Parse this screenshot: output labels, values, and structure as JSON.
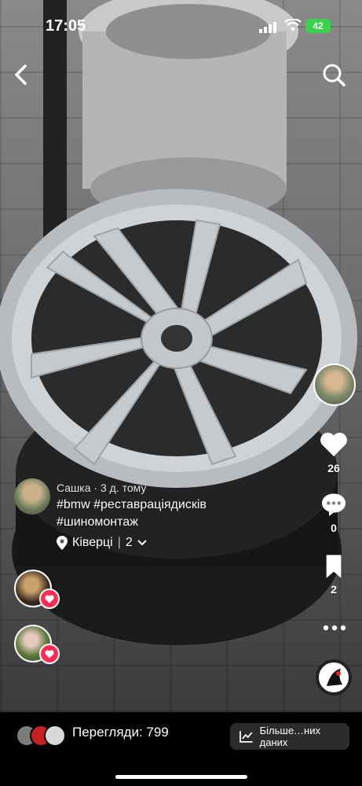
{
  "status_bar": {
    "time": "17:05",
    "battery": "42"
  },
  "video": {
    "description_icon": "wheel-rim-photo"
  },
  "sidebar": {
    "likes": "26",
    "comments": "0",
    "saves": "2"
  },
  "caption": {
    "author": "Сашка",
    "age": "3 д. тому",
    "hashtags_line1": "#bmw #реставраціядисків",
    "hashtags_line2": "#шиномонтаж",
    "location": "Ківерці",
    "location_count": "2"
  },
  "bottom_bar": {
    "views_label": "Перегляди: 799",
    "analytics_label": "Більше…них даних"
  },
  "colors": {
    "accent": "#fe2c55",
    "battery": "#3ad24d"
  }
}
